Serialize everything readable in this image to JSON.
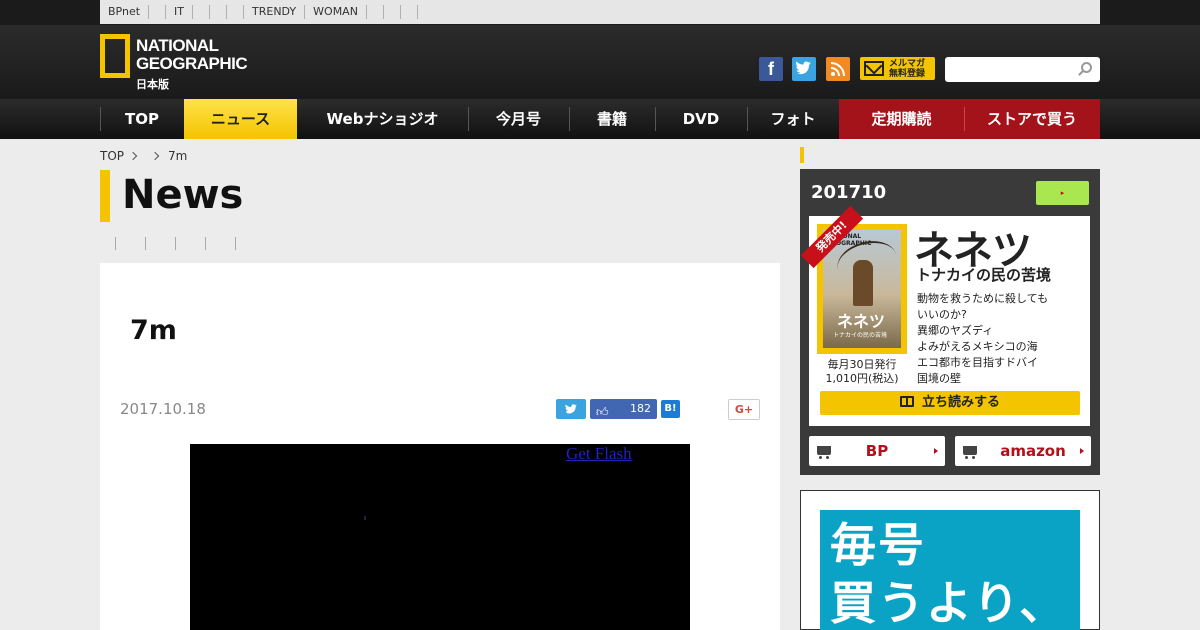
{
  "topbar": {
    "links": [
      "BPnet",
      "",
      "IT",
      "",
      "",
      "",
      "TRENDY",
      "WOMAN",
      "",
      "",
      ""
    ]
  },
  "header": {
    "logo_line1": "NATIONAL",
    "logo_line2": "GEOGRAPHIC",
    "logo_sub": "日本版",
    "newsletter_line1": "メルマガ",
    "newsletter_line2": "無料登録",
    "search_placeholder": ""
  },
  "nav": {
    "items": [
      "TOP",
      "ニュース",
      "Webナショジオ",
      "今月号",
      "書籍",
      "DVD",
      "フォト",
      "定期購読",
      "ストアで買う"
    ]
  },
  "breadcrumb": {
    "items": [
      "TOP",
      "",
      "7m"
    ]
  },
  "section_title": "News",
  "article": {
    "title": "7m",
    "date": "2017.10.18",
    "like_count": "182",
    "gplus": "G+",
    "hatena": "B!",
    "get_flash": "Get Flash"
  },
  "sidebar": {
    "issue": "201710",
    "issue_button": "▸",
    "badge": "発売中!",
    "cover_logo": "NATIONAL GEOGRAPHIC",
    "cover_title": "ネネツ",
    "cover_sub": "トナカイの民の苦境",
    "issue_meta_line1": "毎月30日発行",
    "issue_meta_line2": "1,010円(税込)",
    "headline": "ネネツ",
    "subhead": "トナカイの民の苦境",
    "topics": [
      "動物を救うために殺しても",
      "いいのか?",
      "異郷のヤズディ",
      "よみがえるメキシコの海",
      "エコ都市を目指すドバイ",
      "国境の壁"
    ],
    "read_button": "立ち読みする",
    "buy_bp": "BP",
    "buy_amazon": "amazon",
    "ad_line1": "毎号",
    "ad_line2": "買うより、"
  },
  "colors": {
    "accent_yellow": "#f5c400",
    "red": "#a4121a",
    "facebook": "#3b5998",
    "twitter": "#3aa3e0",
    "rss": "#f08a24"
  }
}
